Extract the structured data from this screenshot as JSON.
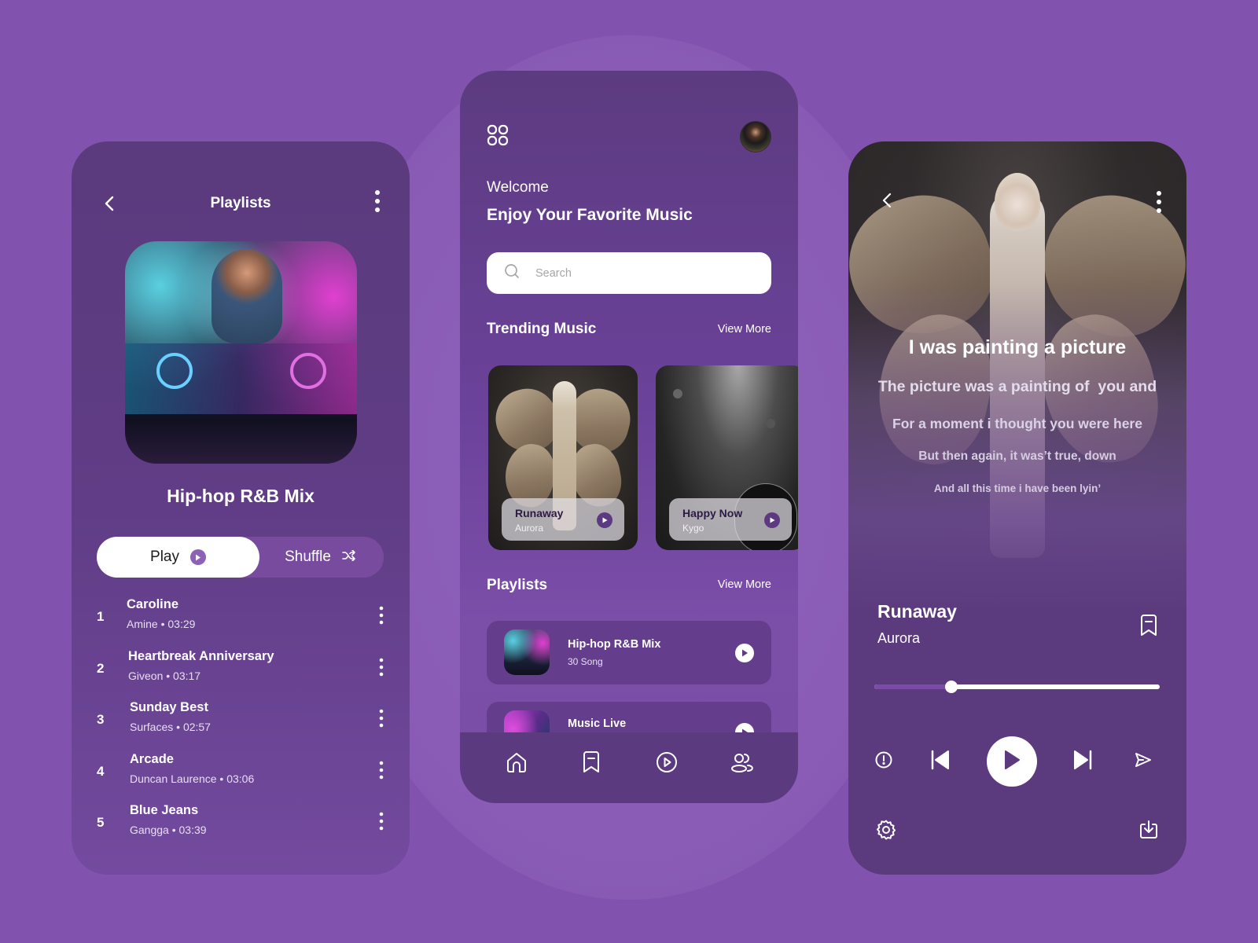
{
  "colors": {
    "background": "#8153ae",
    "panel": "#5c3a7e",
    "accent": "#7a4ca8",
    "white": "#ffffff"
  },
  "left_panel": {
    "header": {
      "back_icon": "chevron-left-icon",
      "title": "Playlists",
      "more_icon": "more-vertical-icon"
    },
    "cover_image": "dj-mixing-console-photo",
    "playlist_name": "Hip-hop R&B Mix",
    "play_button": {
      "label": "Play",
      "icon": "play-circle-icon"
    },
    "shuffle_button": {
      "label": "Shuffle",
      "icon": "shuffle-icon"
    },
    "tracks": [
      {
        "number": "1",
        "title": "Caroline",
        "artist": "Amine",
        "separator": "•",
        "duration": "03:29"
      },
      {
        "number": "2",
        "title": "Heartbreak Anniversary",
        "artist": "Giveon",
        "separator": "•",
        "duration": "03:17"
      },
      {
        "number": "3",
        "title": "Sunday Best",
        "artist": "Surfaces",
        "separator": "•",
        "duration": "02:57"
      },
      {
        "number": "4",
        "title": "Arcade",
        "artist": "Duncan Laurence",
        "separator": "•",
        "duration": "03:06"
      },
      {
        "number": "5",
        "title": "Blue Jeans",
        "artist": "Gangga",
        "separator": "•",
        "duration": "03:39"
      }
    ]
  },
  "middle_panel": {
    "menu_icon": "grid-icon",
    "avatar": "user-avatar-photo",
    "welcome": "Welcome",
    "headline": "Enjoy Your Favorite Music",
    "search": {
      "placeholder": "Search",
      "value": "",
      "icon": "search-icon"
    },
    "trending": {
      "title": "Trending Music",
      "view_more": "View More",
      "cards": [
        {
          "title": "Runaway",
          "artist": "Aurora",
          "image": "butterfly-wings-woman-photo"
        },
        {
          "title": "Happy Now",
          "artist": "Kygo",
          "image": "concert-spotlight-photo"
        }
      ]
    },
    "playlists": {
      "title": "Playlists",
      "view_more": "View More",
      "items": [
        {
          "name": "Hip-hop R&B Mix",
          "count": "30 Song"
        },
        {
          "name": "Music Live",
          "count": ""
        }
      ]
    },
    "bottom_nav": [
      {
        "name": "home",
        "icon": "home-icon",
        "active": true
      },
      {
        "name": "saved",
        "icon": "bookmark-icon",
        "active": false
      },
      {
        "name": "player",
        "icon": "play-circle-icon",
        "active": false
      },
      {
        "name": "profile",
        "icon": "users-icon",
        "active": false
      }
    ]
  },
  "right_panel": {
    "header": {
      "back_icon": "chevron-left-icon",
      "more_icon": "more-vertical-icon"
    },
    "artwork": "butterfly-wings-woman-photo",
    "lyrics": [
      "I was painting a picture",
      "The picture was a painting of  you and",
      "For a moment i thought you were here",
      "But then again, it was’t true, down",
      "And all this time i have been lyin’"
    ],
    "now_playing": {
      "title": "Runaway",
      "artist": "Aurora"
    },
    "progress_percent": 27,
    "controls": {
      "info": "info-icon",
      "previous": "skip-back-icon",
      "play": "play-icon",
      "next": "skip-forward-icon",
      "share": "send-icon"
    },
    "footer": {
      "settings": "gear-icon",
      "download": "download-icon"
    }
  }
}
